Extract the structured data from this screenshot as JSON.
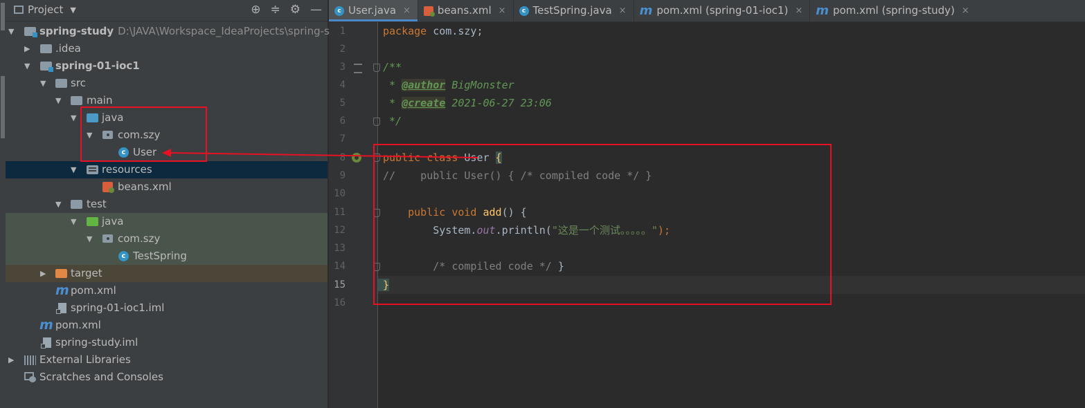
{
  "project_panel": {
    "title": "Project",
    "header_icons": [
      "target-icon",
      "collapse-all-icon",
      "gear-icon",
      "minimize-icon"
    ],
    "tree": [
      {
        "label": "spring-study",
        "path": "D:\\JAVA\\Workspace_IdeaProjects\\spring-st",
        "icon": "module-folder-icon",
        "arrow": "▼"
      },
      {
        "label": ".idea",
        "icon": "folder-icon",
        "arrow": "▶"
      },
      {
        "label": "spring-01-ioc1",
        "icon": "module-folder-icon",
        "arrow": "▼"
      },
      {
        "label": "src",
        "icon": "folder-icon",
        "arrow": "▼"
      },
      {
        "label": "main",
        "icon": "folder-icon",
        "arrow": "▼"
      },
      {
        "label": "java",
        "icon": "source-folder-icon",
        "arrow": "▼"
      },
      {
        "label": "com.szy",
        "icon": "package-icon",
        "arrow": "▼"
      },
      {
        "label": "User",
        "icon": "class-icon"
      },
      {
        "label": "resources",
        "icon": "resources-folder-icon",
        "arrow": "▼"
      },
      {
        "label": "beans.xml",
        "icon": "spring-xml-icon"
      },
      {
        "label": "test",
        "icon": "folder-icon",
        "arrow": "▼"
      },
      {
        "label": "java",
        "icon": "test-source-folder-icon",
        "arrow": "▼"
      },
      {
        "label": "com.szy",
        "icon": "package-icon",
        "arrow": "▼"
      },
      {
        "label": "TestSpring",
        "icon": "class-icon"
      },
      {
        "label": "target",
        "icon": "excluded-folder-icon",
        "arrow": "▶"
      },
      {
        "label": "pom.xml",
        "icon": "maven-icon"
      },
      {
        "label": "spring-01-ioc1.iml",
        "icon": "iml-file-icon"
      },
      {
        "label": "pom.xml",
        "icon": "maven-icon"
      },
      {
        "label": "spring-study.iml",
        "icon": "iml-file-icon"
      },
      {
        "label": "External Libraries",
        "icon": "library-icon",
        "arrow": "▶"
      },
      {
        "label": "Scratches and Consoles",
        "icon": "scratches-icon"
      }
    ]
  },
  "editor_tabs": [
    {
      "label": "User.java",
      "icon": "class-icon",
      "active": true
    },
    {
      "label": "beans.xml",
      "icon": "spring-xml-icon"
    },
    {
      "label": "TestSpring.java",
      "icon": "class-icon"
    },
    {
      "label": "pom.xml (spring-01-ioc1)",
      "icon": "maven-icon"
    },
    {
      "label": "pom.xml (spring-study)",
      "icon": "maven-icon"
    }
  ],
  "tab_close_glyph": "×",
  "code": {
    "line_numbers": [
      "1",
      "2",
      "3",
      "4",
      "5",
      "6",
      "7",
      "8",
      "9",
      "10",
      "11",
      "12",
      "13",
      "14",
      "15",
      "16"
    ],
    "current_line": "15",
    "l1": {
      "kw": "package",
      "rest": " com.szy;"
    },
    "l3": "/**",
    "l4": {
      "star": " * ",
      "tag": "@author",
      "val": " BigMonster"
    },
    "l5": {
      "star": " * ",
      "tag": "@create",
      "val": " 2021-06-27 23:06"
    },
    "l6": " */",
    "l8": {
      "kw": "public class",
      "name": " User ",
      "brace": "{"
    },
    "l9": "//    public User() { /* compiled code */ }",
    "l11": {
      "indent": "    ",
      "kw": "public void",
      "fn": "add",
      "rest": "() {"
    },
    "l12": {
      "indent": "        System.",
      "field": "out",
      "call": ".println(",
      "str": "\"这是一个测试。。。。。\"",
      "end": ");"
    },
    "l14": {
      "indent": "        ",
      "comment": "/* compiled code */",
      "end": " }"
    },
    "l15": "}"
  }
}
